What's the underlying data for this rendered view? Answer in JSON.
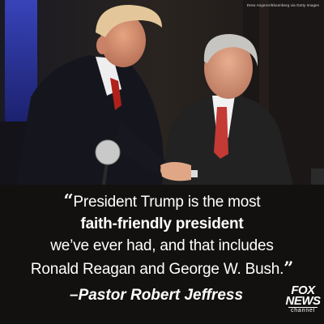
{
  "photo": {
    "credit": "Drew Angerer/Bloomberg via Getty Images"
  },
  "quote": {
    "open_mark": "“",
    "line1": "President Trump is the most",
    "line2_bold": "faith-friendly president",
    "line3": "we’ve ever had, and that includes",
    "line4": "Ronald Reagan and George W. Bush.",
    "close_mark": "”"
  },
  "attribution": "–Pastor Robert Jeffress",
  "logo": {
    "line1": "FOX",
    "line2": "NEWS",
    "line3": "channel"
  }
}
